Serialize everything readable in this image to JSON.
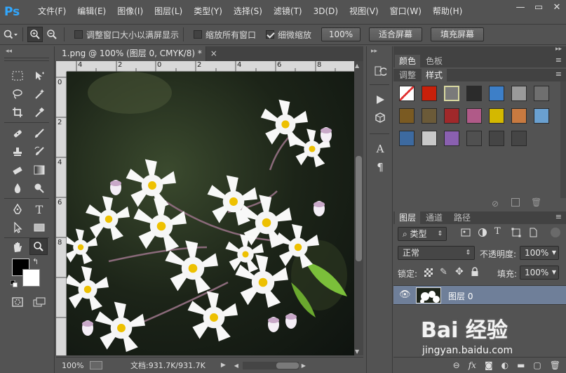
{
  "app": {
    "logo": "Ps"
  },
  "menu": [
    "文件(F)",
    "编辑(E)",
    "图像(I)",
    "图层(L)",
    "类型(Y)",
    "选择(S)",
    "滤镜(T)",
    "3D(D)",
    "视图(V)",
    "窗口(W)",
    "帮助(H)"
  ],
  "window_controls": {
    "minimize": "—",
    "restore": "▭",
    "close": "✕"
  },
  "options": {
    "resize_windows_label": "调整窗口大小以满屏显示",
    "resize_windows_checked": false,
    "zoom_all_label": "缩放所有窗口",
    "zoom_all_checked": false,
    "scrubby_zoom_label": "细微缩放",
    "scrubby_zoom_checked": true,
    "percent_btn": "100%",
    "fit_screen_btn": "适合屏幕",
    "fill_screen_btn": "填充屏幕"
  },
  "document": {
    "tab_title": "1.png @ 100% (图层 0, CMYK/8) *",
    "tab_close": "×",
    "ruler_top": [
      "4",
      "2",
      "0",
      "2",
      "4",
      "6",
      "8",
      "10",
      "12",
      "14",
      "16"
    ],
    "ruler_left": [
      "0",
      "2",
      "4",
      "6",
      "8"
    ],
    "status_zoom": "100%",
    "status_doc": "文档:931.7K/931.7K"
  },
  "dock": {
    "text_tool_label": "A",
    "paragraph_label": "¶"
  },
  "panels": {
    "color_tabs": [
      "颜色",
      "色板"
    ],
    "adjust_tabs": [
      "调整",
      "样式"
    ],
    "active_adjust_tab": "样式",
    "layers_tabs": [
      "图层",
      "通道",
      "路径"
    ],
    "filter_kind": "类型",
    "blend_mode": "正常",
    "opacity_label": "不透明度:",
    "opacity_value": "100%",
    "lock_label": "锁定:",
    "fill_label": "填充:",
    "fill_value": "100%",
    "layer_name": "图层 0",
    "eye_icon": "visible"
  },
  "style_swatch_colors": [
    "#e03030",
    "#c8200a",
    "#7a7a7a",
    "#2b2b2b",
    "#3d7fc8",
    "#9a9a9a",
    "#6f6f6f",
    "#7a5a22",
    "#6b5a38",
    "#a0282a",
    "#b05a88",
    "#d4b800",
    "#c87a40",
    "#6aa0d0",
    "#3d6aa0",
    "#c8c8c8",
    "#8a60b0",
    "#505050",
    "#454545",
    "#454545"
  ],
  "watermark": {
    "brand": "Bai 经验",
    "url": "jingyan.baidu.com"
  }
}
